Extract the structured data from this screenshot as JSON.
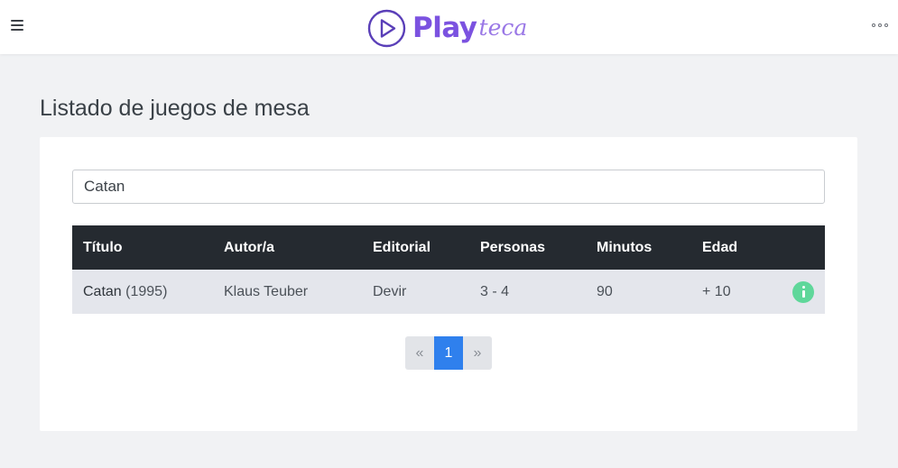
{
  "app": {
    "logo_play": "Play",
    "logo_teca": "teca",
    "brand_color": "#7b52e0"
  },
  "page": {
    "title": "Listado de juegos de mesa"
  },
  "search": {
    "value": "Catan"
  },
  "table": {
    "headers": [
      "Título",
      "Autor/a",
      "Editorial",
      "Personas",
      "Minutos",
      "Edad"
    ],
    "rows": [
      {
        "title": "Catan",
        "year": "(1995)",
        "author": "Klaus Teuber",
        "publisher": "Devir",
        "players": "3 - 4",
        "minutes": "90",
        "age": "+ 10",
        "info_icon": "info-icon"
      }
    ]
  },
  "pagination": {
    "prev": "«",
    "current": "1",
    "next": "»"
  },
  "colors": {
    "header_bg": "#252a30",
    "row_bg": "#e4e6ec",
    "accent_blue": "#2f80ed",
    "info_green": "#5fd79a"
  }
}
